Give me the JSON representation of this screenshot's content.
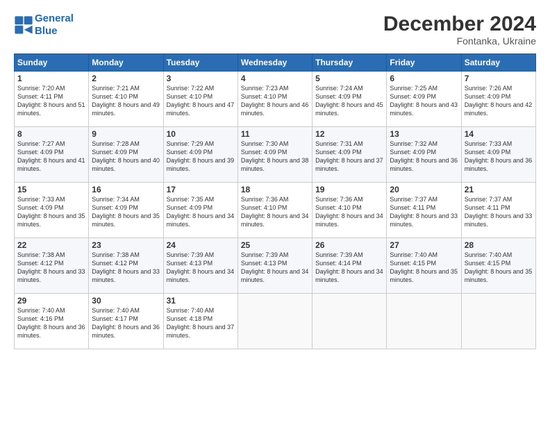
{
  "header": {
    "logo_line1": "General",
    "logo_line2": "Blue",
    "month": "December 2024",
    "location": "Fontanka, Ukraine"
  },
  "days_of_week": [
    "Sunday",
    "Monday",
    "Tuesday",
    "Wednesday",
    "Thursday",
    "Friday",
    "Saturday"
  ],
  "weeks": [
    [
      {
        "day": "1",
        "sunrise": "Sunrise: 7:20 AM",
        "sunset": "Sunset: 4:11 PM",
        "daylight": "Daylight: 8 hours and 51 minutes."
      },
      {
        "day": "2",
        "sunrise": "Sunrise: 7:21 AM",
        "sunset": "Sunset: 4:10 PM",
        "daylight": "Daylight: 8 hours and 49 minutes."
      },
      {
        "day": "3",
        "sunrise": "Sunrise: 7:22 AM",
        "sunset": "Sunset: 4:10 PM",
        "daylight": "Daylight: 8 hours and 47 minutes."
      },
      {
        "day": "4",
        "sunrise": "Sunrise: 7:23 AM",
        "sunset": "Sunset: 4:10 PM",
        "daylight": "Daylight: 8 hours and 46 minutes."
      },
      {
        "day": "5",
        "sunrise": "Sunrise: 7:24 AM",
        "sunset": "Sunset: 4:09 PM",
        "daylight": "Daylight: 8 hours and 45 minutes."
      },
      {
        "day": "6",
        "sunrise": "Sunrise: 7:25 AM",
        "sunset": "Sunset: 4:09 PM",
        "daylight": "Daylight: 8 hours and 43 minutes."
      },
      {
        "day": "7",
        "sunrise": "Sunrise: 7:26 AM",
        "sunset": "Sunset: 4:09 PM",
        "daylight": "Daylight: 8 hours and 42 minutes."
      }
    ],
    [
      {
        "day": "8",
        "sunrise": "Sunrise: 7:27 AM",
        "sunset": "Sunset: 4:09 PM",
        "daylight": "Daylight: 8 hours and 41 minutes."
      },
      {
        "day": "9",
        "sunrise": "Sunrise: 7:28 AM",
        "sunset": "Sunset: 4:09 PM",
        "daylight": "Daylight: 8 hours and 40 minutes."
      },
      {
        "day": "10",
        "sunrise": "Sunrise: 7:29 AM",
        "sunset": "Sunset: 4:09 PM",
        "daylight": "Daylight: 8 hours and 39 minutes."
      },
      {
        "day": "11",
        "sunrise": "Sunrise: 7:30 AM",
        "sunset": "Sunset: 4:09 PM",
        "daylight": "Daylight: 8 hours and 38 minutes."
      },
      {
        "day": "12",
        "sunrise": "Sunrise: 7:31 AM",
        "sunset": "Sunset: 4:09 PM",
        "daylight": "Daylight: 8 hours and 37 minutes."
      },
      {
        "day": "13",
        "sunrise": "Sunrise: 7:32 AM",
        "sunset": "Sunset: 4:09 PM",
        "daylight": "Daylight: 8 hours and 36 minutes."
      },
      {
        "day": "14",
        "sunrise": "Sunrise: 7:33 AM",
        "sunset": "Sunset: 4:09 PM",
        "daylight": "Daylight: 8 hours and 36 minutes."
      }
    ],
    [
      {
        "day": "15",
        "sunrise": "Sunrise: 7:33 AM",
        "sunset": "Sunset: 4:09 PM",
        "daylight": "Daylight: 8 hours and 35 minutes."
      },
      {
        "day": "16",
        "sunrise": "Sunrise: 7:34 AM",
        "sunset": "Sunset: 4:09 PM",
        "daylight": "Daylight: 8 hours and 35 minutes."
      },
      {
        "day": "17",
        "sunrise": "Sunrise: 7:35 AM",
        "sunset": "Sunset: 4:09 PM",
        "daylight": "Daylight: 8 hours and 34 minutes."
      },
      {
        "day": "18",
        "sunrise": "Sunrise: 7:36 AM",
        "sunset": "Sunset: 4:10 PM",
        "daylight": "Daylight: 8 hours and 34 minutes."
      },
      {
        "day": "19",
        "sunrise": "Sunrise: 7:36 AM",
        "sunset": "Sunset: 4:10 PM",
        "daylight": "Daylight: 8 hours and 34 minutes."
      },
      {
        "day": "20",
        "sunrise": "Sunrise: 7:37 AM",
        "sunset": "Sunset: 4:11 PM",
        "daylight": "Daylight: 8 hours and 33 minutes."
      },
      {
        "day": "21",
        "sunrise": "Sunrise: 7:37 AM",
        "sunset": "Sunset: 4:11 PM",
        "daylight": "Daylight: 8 hours and 33 minutes."
      }
    ],
    [
      {
        "day": "22",
        "sunrise": "Sunrise: 7:38 AM",
        "sunset": "Sunset: 4:12 PM",
        "daylight": "Daylight: 8 hours and 33 minutes."
      },
      {
        "day": "23",
        "sunrise": "Sunrise: 7:38 AM",
        "sunset": "Sunset: 4:12 PM",
        "daylight": "Daylight: 8 hours and 33 minutes."
      },
      {
        "day": "24",
        "sunrise": "Sunrise: 7:39 AM",
        "sunset": "Sunset: 4:13 PM",
        "daylight": "Daylight: 8 hours and 34 minutes."
      },
      {
        "day": "25",
        "sunrise": "Sunrise: 7:39 AM",
        "sunset": "Sunset: 4:13 PM",
        "daylight": "Daylight: 8 hours and 34 minutes."
      },
      {
        "day": "26",
        "sunrise": "Sunrise: 7:39 AM",
        "sunset": "Sunset: 4:14 PM",
        "daylight": "Daylight: 8 hours and 34 minutes."
      },
      {
        "day": "27",
        "sunrise": "Sunrise: 7:40 AM",
        "sunset": "Sunset: 4:15 PM",
        "daylight": "Daylight: 8 hours and 35 minutes."
      },
      {
        "day": "28",
        "sunrise": "Sunrise: 7:40 AM",
        "sunset": "Sunset: 4:15 PM",
        "daylight": "Daylight: 8 hours and 35 minutes."
      }
    ],
    [
      {
        "day": "29",
        "sunrise": "Sunrise: 7:40 AM",
        "sunset": "Sunset: 4:16 PM",
        "daylight": "Daylight: 8 hours and 36 minutes."
      },
      {
        "day": "30",
        "sunrise": "Sunrise: 7:40 AM",
        "sunset": "Sunset: 4:17 PM",
        "daylight": "Daylight: 8 hours and 36 minutes."
      },
      {
        "day": "31",
        "sunrise": "Sunrise: 7:40 AM",
        "sunset": "Sunset: 4:18 PM",
        "daylight": "Daylight: 8 hours and 37 minutes."
      },
      null,
      null,
      null,
      null
    ]
  ]
}
